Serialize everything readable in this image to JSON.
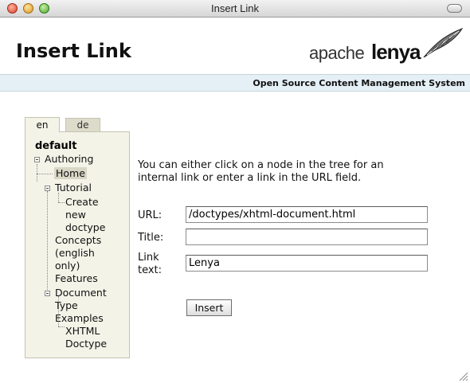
{
  "window": {
    "title": "Insert Link"
  },
  "header": {
    "heading": "Insert Link",
    "logo_apache": "apache",
    "logo_lenya": "lenya",
    "tagline": "Open Source Content Management System"
  },
  "tabs": [
    {
      "label": "en",
      "active": true
    },
    {
      "label": "de",
      "active": false
    }
  ],
  "tree": {
    "root": "default",
    "authoring": "Authoring",
    "home": "Home",
    "tutorial": "Tutorial",
    "create_1": "Create",
    "create_2": "new",
    "create_3": "doctype",
    "concepts_1": "Concepts",
    "concepts_2": "(english",
    "concepts_3": "only)",
    "features": "Features",
    "document_1": "Document",
    "document_2": "Type",
    "document_3": "Examples",
    "xhtml_1": "XHTML",
    "xhtml_2": "Doctype"
  },
  "form": {
    "instructions": "You can either click on a node in the tree for an internal link or enter a link in the URL field.",
    "url_label": "URL:",
    "url_value": "/doctypes/xhtml-document.html",
    "title_label": "Title:",
    "title_value": "",
    "linktext_label_1": "Link",
    "linktext_label_2": "text:",
    "linktext_value": "Lenya",
    "insert_label": "Insert"
  },
  "colors": {
    "subbar": "#e4eff6",
    "tree_bg": "#f4f3e8",
    "selected_bg": "#d8d7c6"
  }
}
